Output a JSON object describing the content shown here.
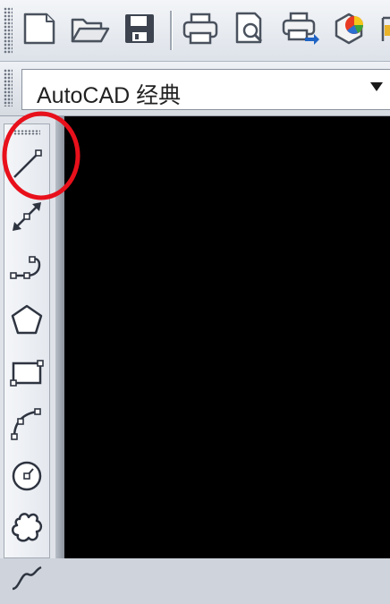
{
  "workspace": {
    "selected": "AutoCAD 经典"
  },
  "toolbar": {
    "buttons": [
      {
        "name": "new",
        "icon": "new-document-icon"
      },
      {
        "name": "open",
        "icon": "open-folder-icon"
      },
      {
        "name": "save",
        "icon": "save-disk-icon"
      },
      {
        "name": "plot",
        "icon": "printer-icon"
      },
      {
        "name": "plot-preview",
        "icon": "print-preview-icon"
      },
      {
        "name": "publish",
        "icon": "publish-icon"
      },
      {
        "name": "3d-dwf",
        "icon": "3d-dwf-icon"
      }
    ]
  },
  "draw_toolbar": {
    "tools": [
      {
        "name": "line",
        "icon": "line-icon",
        "highlighted": true
      },
      {
        "name": "construction-line",
        "icon": "construction-line-icon"
      },
      {
        "name": "polyline",
        "icon": "polyline-icon"
      },
      {
        "name": "polygon",
        "icon": "polygon-icon"
      },
      {
        "name": "rectangle",
        "icon": "rectangle-icon"
      },
      {
        "name": "arc",
        "icon": "arc-icon"
      },
      {
        "name": "circle",
        "icon": "circle-icon"
      },
      {
        "name": "revision-cloud",
        "icon": "revision-cloud-icon"
      },
      {
        "name": "spline",
        "icon": "spline-icon"
      }
    ]
  },
  "colors": {
    "canvas": "#000000",
    "highlight": "#e8101b",
    "toolbar": "#dde2e9"
  }
}
